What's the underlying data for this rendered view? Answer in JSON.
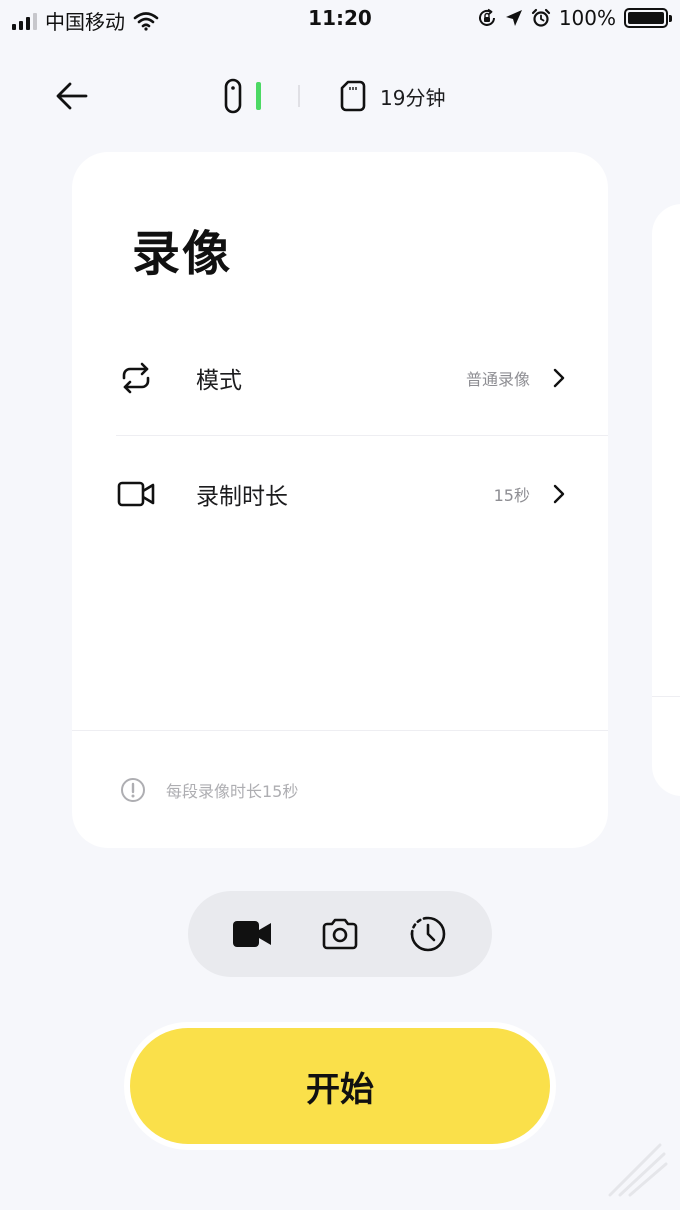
{
  "status_bar": {
    "carrier": "中国移动",
    "time": "11:20",
    "battery": "100%"
  },
  "header": {
    "storage_time": "19分钟"
  },
  "card": {
    "title": "录像",
    "rows": [
      {
        "label": "模式",
        "value": "普通录像"
      },
      {
        "label": "录制时长",
        "value": "15秒"
      }
    ],
    "footer_note": "每段录像时长15秒"
  },
  "mode_switcher": {
    "items": [
      "video-icon",
      "camera-icon",
      "timelapse-icon"
    ],
    "selected": "video-icon"
  },
  "start_button": {
    "label": "开始"
  },
  "colors": {
    "background": "#f6f7fb",
    "accent": "#fae04a",
    "device_battery": "#4cd964",
    "switcher_bg": "#e9eaee"
  }
}
